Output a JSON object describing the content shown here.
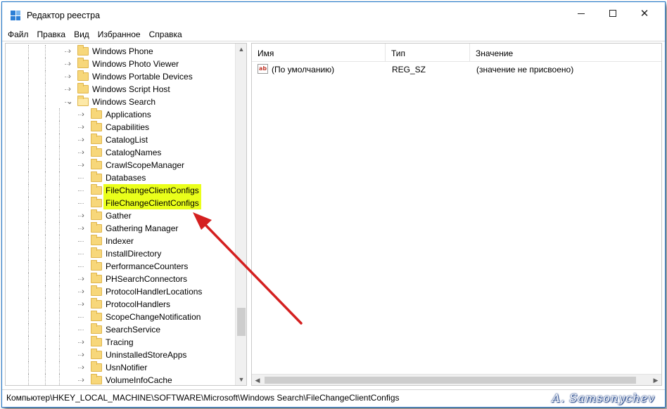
{
  "window": {
    "title": "Редактор реестра",
    "controls": {
      "minimize": "",
      "maximize": "",
      "close": "✕"
    }
  },
  "menu": [
    "Файл",
    "Правка",
    "Вид",
    "Избранное",
    "Справка"
  ],
  "tree": {
    "items": [
      {
        "label": "Windows Phone",
        "level": 1,
        "expander": "›"
      },
      {
        "label": "Windows Photo Viewer",
        "level": 1,
        "expander": "›"
      },
      {
        "label": "Windows Portable Devices",
        "level": 1,
        "expander": "›"
      },
      {
        "label": "Windows Script Host",
        "level": 1,
        "expander": "›"
      },
      {
        "label": "Windows Search",
        "level": 1,
        "expander": "⌄",
        "open": true
      },
      {
        "label": "Applications",
        "level": 2,
        "expander": "›"
      },
      {
        "label": "Capabilities",
        "level": 2,
        "expander": "›"
      },
      {
        "label": "CatalogList",
        "level": 2,
        "expander": "›"
      },
      {
        "label": "CatalogNames",
        "level": 2,
        "expander": "›"
      },
      {
        "label": "CrawlScopeManager",
        "level": 2,
        "expander": "›"
      },
      {
        "label": "Databases",
        "level": 2,
        "expander": ""
      },
      {
        "label": "FileChangeClientConfigs",
        "level": 2,
        "expander": "",
        "highlighted": true
      },
      {
        "label": "FileChangeClientConfigs",
        "level": 2,
        "expander": "",
        "highlighted": true
      },
      {
        "label": "Gather",
        "level": 2,
        "expander": "›"
      },
      {
        "label": "Gathering Manager",
        "level": 2,
        "expander": "›"
      },
      {
        "label": "Indexer",
        "level": 2,
        "expander": ""
      },
      {
        "label": "InstallDirectory",
        "level": 2,
        "expander": ""
      },
      {
        "label": "PerformanceCounters",
        "level": 2,
        "expander": ""
      },
      {
        "label": "PHSearchConnectors",
        "level": 2,
        "expander": "›"
      },
      {
        "label": "ProtocolHandlerLocations",
        "level": 2,
        "expander": "›"
      },
      {
        "label": "ProtocolHandlers",
        "level": 2,
        "expander": "›"
      },
      {
        "label": "ScopeChangeNotification",
        "level": 2,
        "expander": ""
      },
      {
        "label": "SearchService",
        "level": 2,
        "expander": ""
      },
      {
        "label": "Tracing",
        "level": 2,
        "expander": "›"
      },
      {
        "label": "UninstalledStoreApps",
        "level": 2,
        "expander": "›"
      },
      {
        "label": "UsnNotifier",
        "level": 2,
        "expander": "›"
      },
      {
        "label": "VolumeInfoCache",
        "level": 2,
        "expander": "›"
      }
    ],
    "highlight_color": "#eaff1a"
  },
  "values": {
    "columns": {
      "name": "Имя",
      "type": "Тип",
      "data": "Значение"
    },
    "rows": [
      {
        "icon": "ab",
        "name": "(По умолчанию)",
        "type": "REG_SZ",
        "data": "(значение не присвоено)"
      }
    ]
  },
  "scroll": {
    "up": "▲",
    "down": "▼",
    "left": "◀",
    "right": "▶"
  },
  "status": {
    "path": "Компьютер\\HKEY_LOCAL_MACHINE\\SOFTWARE\\Microsoft\\Windows Search\\FileChangeClientConfigs",
    "signature": "A. Samsonychev"
  },
  "annotation": {
    "arrow_color": "#d42020"
  }
}
